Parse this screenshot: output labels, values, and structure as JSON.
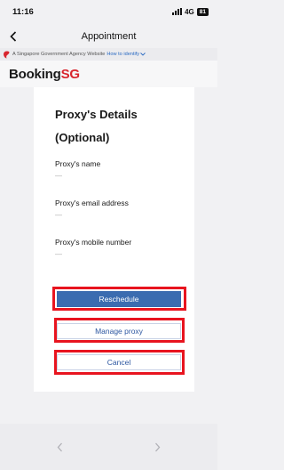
{
  "status_bar": {
    "time": "11:16",
    "network": "4G",
    "battery": "81"
  },
  "nav": {
    "title": "Appointment",
    "back_icon": "chevron-left-icon"
  },
  "gov_banner": {
    "text": "A Singapore Government Agency Website",
    "link": "How to identify",
    "lion_icon": "singapore-lion-icon",
    "chevron_icon": "chevron-down-icon"
  },
  "header": {
    "logo_part1": "Booking",
    "logo_part2": "SG",
    "brand_color": "#d8262e"
  },
  "proxy_section": {
    "heading_line1": "Proxy's Details",
    "heading_line2": "(Optional)",
    "fields": [
      {
        "label": "Proxy's name",
        "value": "—"
      },
      {
        "label": "Proxy's email address",
        "value": "—"
      },
      {
        "label": "Proxy's mobile number",
        "value": "—"
      }
    ]
  },
  "actions": {
    "reschedule": "Reschedule",
    "manage_proxy": "Manage proxy",
    "cancel": "Cancel",
    "primary_color": "#3b6cb0",
    "highlight_color": "#e8141f"
  },
  "bottom_nav": {
    "back_icon": "chevron-left-icon",
    "forward_icon": "chevron-right-icon"
  }
}
